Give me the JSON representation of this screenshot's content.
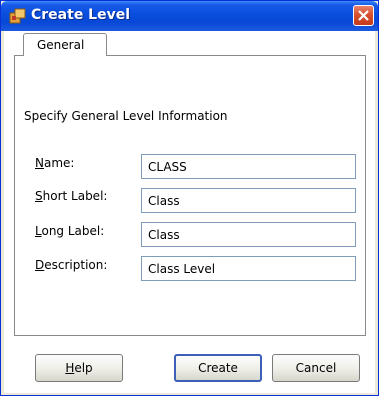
{
  "window": {
    "title": "Create Level",
    "titlebar_color": "#0a4fdf",
    "close_icon": "close-icon"
  },
  "tabs": [
    {
      "label": "General",
      "selected": true
    }
  ],
  "section": {
    "heading": "Specify General Level Information"
  },
  "fields": {
    "name": {
      "mnemonic": "N",
      "label_rest": "ame:",
      "value": "CLASS"
    },
    "short_label": {
      "mnemonic": "S",
      "label_rest": "hort Label:",
      "value": "Class"
    },
    "long_label": {
      "mnemonic": "L",
      "label_rest": "ong Label:",
      "value": "Class"
    },
    "description": {
      "mnemonic": "D",
      "label_rest": "escription:",
      "value": "Class Level"
    }
  },
  "buttons": {
    "help": {
      "mnemonic": "H",
      "label_rest": "elp"
    },
    "create": {
      "label": "Create"
    },
    "cancel": {
      "label": "Cancel"
    }
  }
}
